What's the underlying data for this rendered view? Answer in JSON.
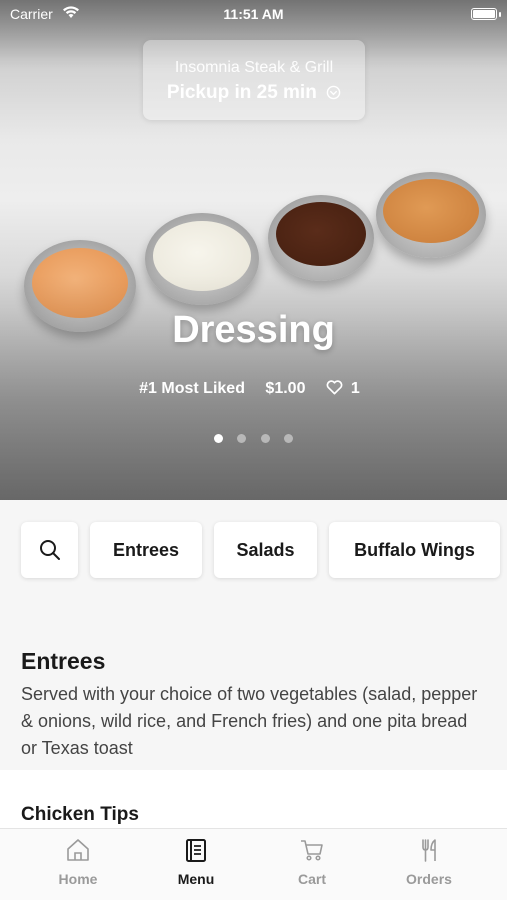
{
  "status_bar": {
    "carrier": "Carrier",
    "time": "11:51 AM"
  },
  "pickup": {
    "restaurant": "Insomnia Steak & Grill",
    "eta": "Pickup in 25 min"
  },
  "featured": {
    "title": "Dressing",
    "rank": "#1 Most Liked",
    "price": "$1.00",
    "likes": "1",
    "slides": 4,
    "active_slide": 0
  },
  "categories": {
    "search_icon": "search-icon",
    "items": [
      "Entrees",
      "Salads",
      "Buffalo Wings"
    ]
  },
  "section": {
    "title": "Entrees",
    "description": "Served with your choice of two vegetables (salad, pepper & onions, wild rice, and French fries) and one pita bread or Texas toast"
  },
  "first_item": {
    "name": "Chicken Tips"
  },
  "tabs": [
    {
      "label": "Home",
      "icon": "home-icon",
      "active": false
    },
    {
      "label": "Menu",
      "icon": "menu-icon",
      "active": true
    },
    {
      "label": "Cart",
      "icon": "cart-icon",
      "active": false
    },
    {
      "label": "Orders",
      "icon": "fork-knife-icon",
      "active": false
    }
  ],
  "colors": {
    "accent": "#1a1a1a",
    "inactive_tab": "#9a9a9a"
  }
}
